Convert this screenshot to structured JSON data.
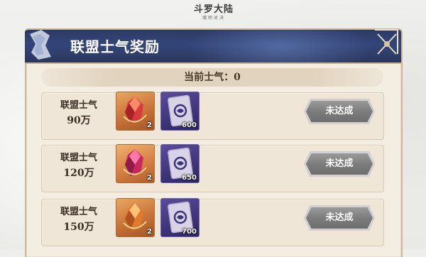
{
  "logo": {
    "title": "斗罗大陆",
    "subtitle": "魂师对决"
  },
  "header": {
    "title": "联盟士气奖励"
  },
  "morale": {
    "text": "当前士气：0"
  },
  "rewards": [
    {
      "label": "联盟士气",
      "amount": "90万",
      "crystal_count": "2",
      "card_count": "600",
      "button": "未达成"
    },
    {
      "label": "联盟士气",
      "amount": "120万",
      "crystal_count": "2",
      "card_count": "650",
      "button": "未达成"
    },
    {
      "label": "联盟士气",
      "amount": "150万",
      "crystal_count": "2",
      "card_count": "700",
      "button": "未达成"
    }
  ],
  "colors": {
    "header_bg": "#2c3a63",
    "panel_bg": "#f4ede2",
    "button_disabled": "#7d7d7d",
    "crystal_bg": "#c8733a",
    "card_bg": "#3e3579"
  }
}
